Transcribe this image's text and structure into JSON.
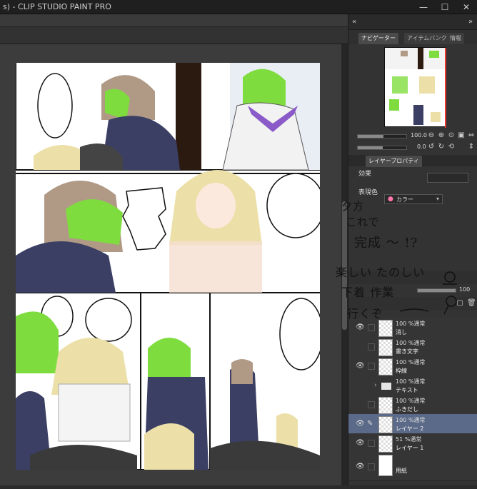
{
  "window": {
    "title": "s) - CLIP STUDIO PAINT PRO",
    "min": "—",
    "max": "☐",
    "close": "✕"
  },
  "navigator": {
    "tabs": [
      "ナビゲーター",
      "アイテムバンク",
      "情報"
    ],
    "zoom_value": "100.0",
    "rotate_value": "0.0"
  },
  "layer_property": {
    "tab": "レイヤープロパティ",
    "effect_label": "効果",
    "expression_color_label": "表現色",
    "expression_color_value": "カラー"
  },
  "layers_toolbar": {
    "opacity_value": "100"
  },
  "layers": [
    {
      "mode": "100 %通常",
      "name": "消し",
      "visible": true,
      "type": "raster"
    },
    {
      "mode": "100 %通常",
      "name": "書き文字",
      "visible": false,
      "type": "raster"
    },
    {
      "mode": "100 %通常",
      "name": "枠線",
      "visible": true,
      "type": "raster"
    },
    {
      "mode": "100 %通常",
      "name": "テキスト",
      "visible": false,
      "type": "folder"
    },
    {
      "mode": "100 %通常",
      "name": "ふきだし",
      "visible": true,
      "type": "raster"
    },
    {
      "mode": "100 %通常",
      "name": "レイヤー 2",
      "visible": true,
      "type": "raster",
      "selected": true
    },
    {
      "mode": "51 %通常",
      "name": "レイヤー 1",
      "visible": true,
      "type": "raster"
    },
    {
      "mode": "",
      "name": "用紙",
      "visible": true,
      "type": "paper"
    }
  ],
  "handwriting": {
    "line1": "夕方",
    "line2": "これで",
    "line3": "完成 〜 !?",
    "line4": "楽しい たのしい",
    "line5": "下着 作業",
    "line6": "行くぞ"
  },
  "colors": {
    "accent_selected": "#5b6a88",
    "panel_bg": "#333333",
    "canvas_bg": "#3c3c3c",
    "hair_green": "#7fdc3f",
    "coat_navy": "#3b3f64"
  }
}
